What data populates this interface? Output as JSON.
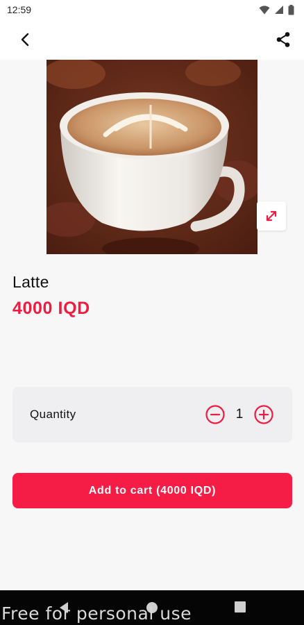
{
  "status_bar": {
    "time": "12:59",
    "icons": [
      "wifi-icon",
      "signal-icon",
      "battery-icon"
    ]
  },
  "app_bar": {
    "back_icon": "back-arrow-icon",
    "share_icon": "share-icon"
  },
  "product": {
    "image_alt": "Latte",
    "name": "Latte",
    "price": "4000 IQD",
    "expand_icon": "expand-icon"
  },
  "quantity": {
    "label": "Quantity",
    "value": "1",
    "decrease_icon": "minus-circle-icon",
    "increase_icon": "plus-circle-icon"
  },
  "cart": {
    "button_label": "Add to cart (4000 IQD)"
  },
  "navigation": {
    "icons": [
      "nav-back-icon",
      "nav-home-icon",
      "nav-recents-icon"
    ]
  },
  "watermark": "Free for personal use",
  "colors": {
    "accent": "#ee1c40",
    "button": "#f51c45",
    "background": "#f7f7f8",
    "card": "#efeff2"
  }
}
